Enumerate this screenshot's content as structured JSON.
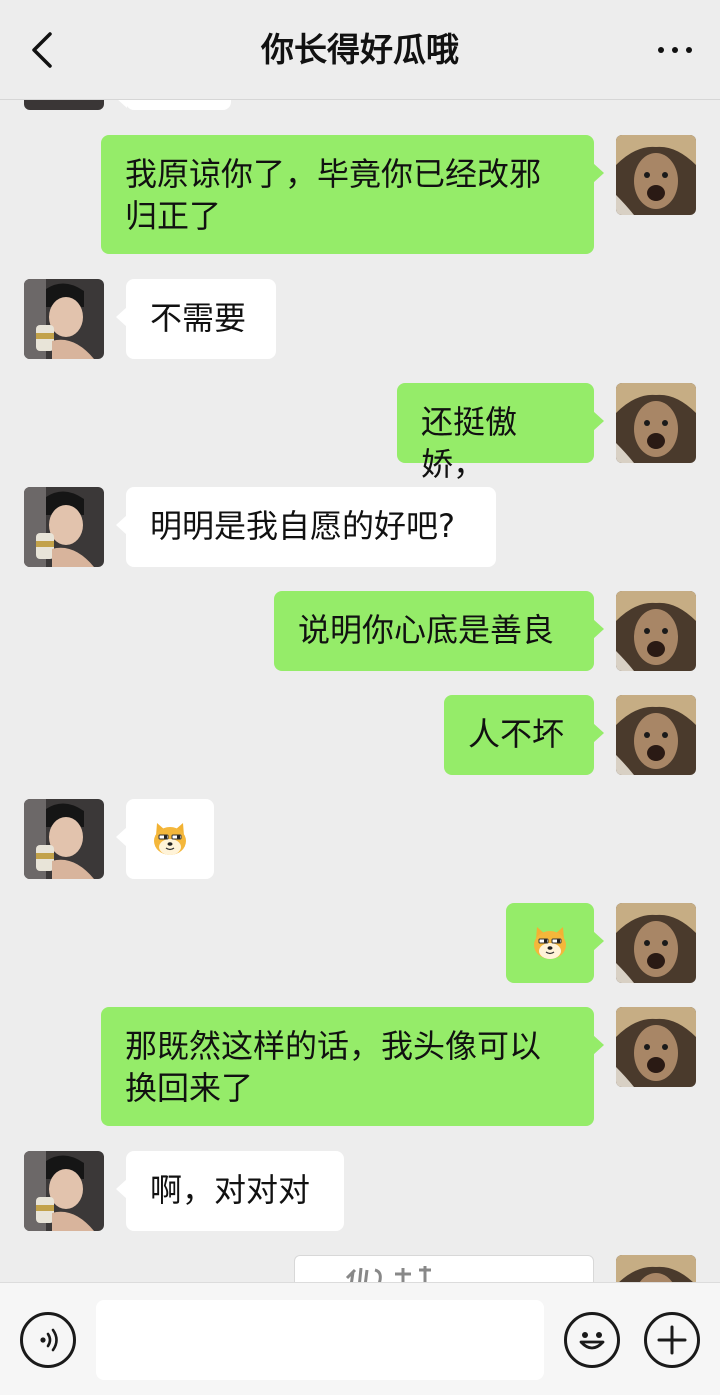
{
  "header": {
    "title": "你长得好瓜哦"
  },
  "messages": [
    {
      "from": "me",
      "text": "我原谅你了，毕竟你已经改邪归正了"
    },
    {
      "from": "them",
      "text": "不需要"
    },
    {
      "from": "me",
      "text": "还挺傲娇，"
    },
    {
      "from": "them",
      "text": "明明是我自愿的好吧?"
    },
    {
      "from": "me",
      "text": "说明你心底是善良"
    },
    {
      "from": "me",
      "text": "人不坏"
    },
    {
      "from": "them",
      "sticker": "doge-sticker"
    },
    {
      "from": "me",
      "sticker": "doge-sticker"
    },
    {
      "from": "me",
      "text": "那既然这样的话，我头像可以换回来了"
    },
    {
      "from": "them",
      "text": "啊，对对对"
    }
  ],
  "input": {
    "value": "",
    "voice_icon": "voice-icon",
    "emoji_icon": "emoji-icon",
    "plus_icon": "plus-icon"
  }
}
